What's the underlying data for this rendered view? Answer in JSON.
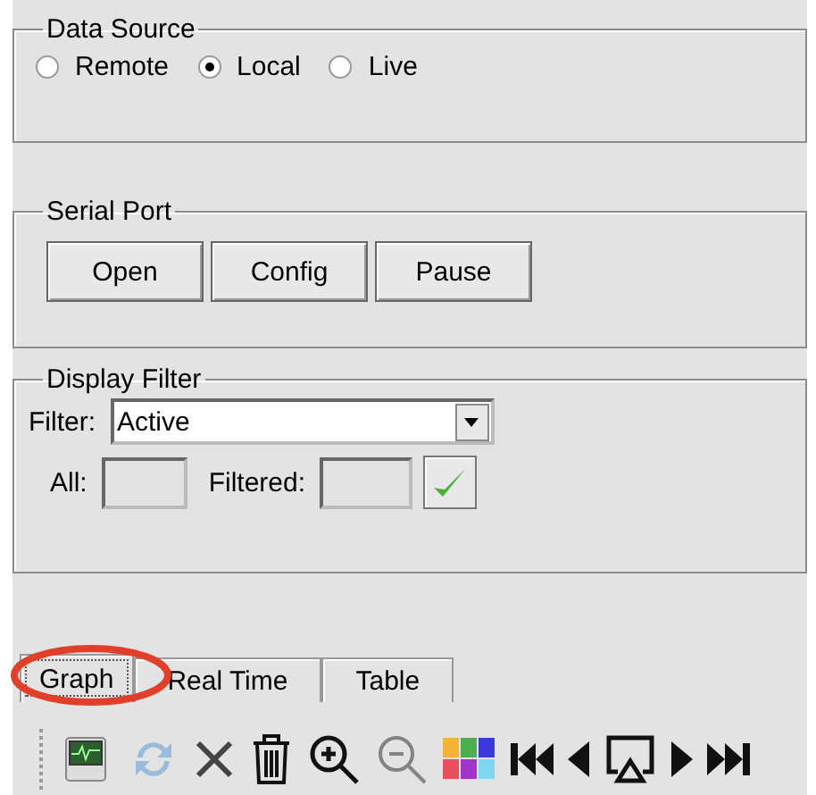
{
  "data_source": {
    "title": "Data Source",
    "options": [
      {
        "label": "Remote",
        "selected": false
      },
      {
        "label": "Local",
        "selected": true
      },
      {
        "label": "Live",
        "selected": false
      }
    ]
  },
  "serial_port": {
    "title": "Serial Port",
    "buttons": [
      "Open",
      "Config",
      "Pause"
    ]
  },
  "display_filter": {
    "title": "Display Filter",
    "filter_label": "Filter:",
    "filter_value": "Active",
    "all_label": "All:",
    "filtered_label": "Filtered:"
  },
  "tabs": [
    {
      "label": "Graph",
      "selected": true,
      "circled": true
    },
    {
      "label": "Real Time",
      "selected": false,
      "circled": false
    },
    {
      "label": "Table",
      "selected": false,
      "circled": false
    }
  ],
  "toolbar": [
    {
      "kind": "monitor",
      "disabled": false
    },
    {
      "kind": "refresh",
      "disabled": true
    },
    {
      "kind": "delete",
      "disabled": false
    },
    {
      "kind": "trash",
      "disabled": false
    },
    {
      "kind": "zoom_in",
      "disabled": false
    },
    {
      "kind": "zoom_out",
      "disabled": true
    },
    {
      "kind": "colors",
      "disabled": false
    },
    {
      "kind": "first",
      "disabled": false
    },
    {
      "kind": "prev",
      "disabled": false
    },
    {
      "kind": "cast",
      "disabled": false
    },
    {
      "kind": "next",
      "disabled": false
    },
    {
      "kind": "last",
      "disabled": false
    }
  ]
}
